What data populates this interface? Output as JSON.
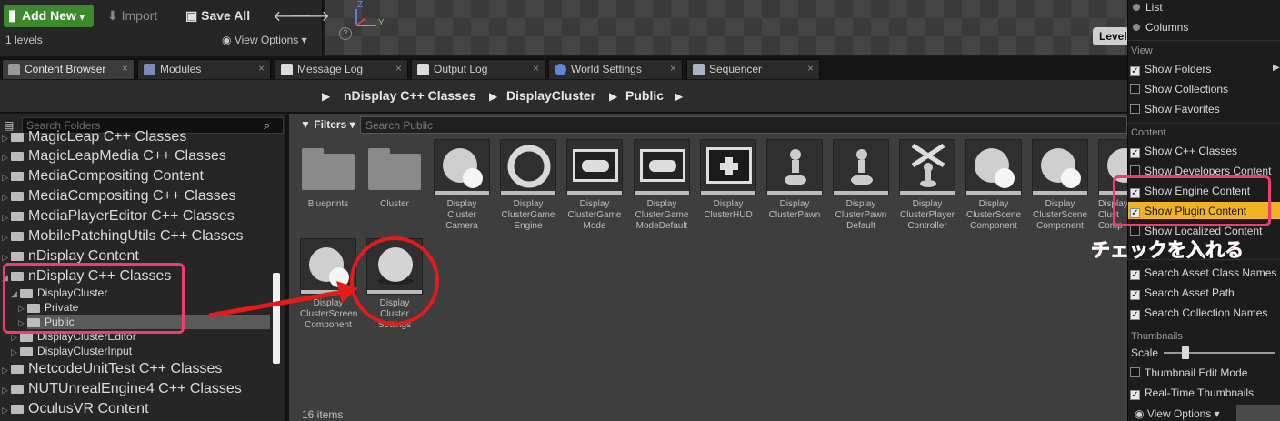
{
  "levels": {
    "count": "1 levels",
    "view_options": "View Options"
  },
  "viewport": {
    "level_badge": "Level:",
    "axis_y": "Y",
    "axis_z": "Z",
    "help": "?"
  },
  "tabs": [
    {
      "label": "Content Browser",
      "icon": "folder-icon"
    },
    {
      "label": "Modules",
      "icon": "modules-icon"
    },
    {
      "label": "Message Log",
      "icon": "message-log-icon"
    },
    {
      "label": "Output Log",
      "icon": "output-log-icon"
    },
    {
      "label": "World Settings",
      "icon": "globe-icon"
    },
    {
      "label": "Sequencer",
      "icon": "sequencer-icon"
    }
  ],
  "toolbar": {
    "add_new": "Add New",
    "import": "Import",
    "save_all": "Save All",
    "breadcrumbs": [
      "nDisplay C++ Classes",
      "DisplayCluster",
      "Public"
    ]
  },
  "sidebar": {
    "search_placeholder": "Search Folders",
    "items": [
      "MagicLeap C++ Classes",
      "MagicLeapMedia C++ Classes",
      "MediaCompositing Content",
      "MediaCompositing C++ Classes",
      "MediaPlayerEditor C++ Classes",
      "MobilePatchingUtils C++ Classes",
      "nDisplay Content",
      "nDisplay C++ Classes",
      "DisplayCluster",
      "Private",
      "Public",
      "DisplayClusterEditor",
      "DisplayClusterInput",
      "NetcodeUnitTest C++ Classes",
      "NUTUnrealEngine4 C++ Classes",
      "OculusVR Content"
    ]
  },
  "main": {
    "filters": "Filters",
    "search_placeholder": "Search Public",
    "items_count": "16 items",
    "assets": [
      {
        "label": "Blueprints",
        "kind": "folder"
      },
      {
        "label": "Cluster",
        "kind": "folder"
      },
      {
        "label": "Display\nCluster\nCamera",
        "kind": "sphere"
      },
      {
        "label": "Display\nClusterGame\nEngine",
        "kind": "ring"
      },
      {
        "label": "Display\nClusterGame\nMode",
        "kind": "gamepad"
      },
      {
        "label": "Display\nClusterGame\nModeDefault",
        "kind": "gamepad"
      },
      {
        "label": "Display\nClusterHUD",
        "kind": "hud"
      },
      {
        "label": "Display\nClusterPawn",
        "kind": "pawn"
      },
      {
        "label": "Display\nClusterPawn\nDefault",
        "kind": "pawn"
      },
      {
        "label": "Display\nClusterPlayer\nController",
        "kind": "controller"
      },
      {
        "label": "Display\nClusterScene\nComponent",
        "kind": "sphere"
      },
      {
        "label": "Display\nClusterScene\nComponent",
        "kind": "sphere"
      },
      {
        "label": "Display\nClust\nComp",
        "kind": "sphere"
      },
      {
        "label": "Display\nClusterScreen\nComponent",
        "kind": "sphere"
      },
      {
        "label": "Display\nCluster\nSettings",
        "kind": "sphere-single"
      }
    ]
  },
  "menu": {
    "list": "List",
    "columns": "Columns",
    "sec_view": "View",
    "show_folders": "Show Folders",
    "show_collections": "Show Collections",
    "show_favorites": "Show Favorites",
    "sec_content": "Content",
    "show_cpp": "Show C++ Classes",
    "show_dev": "Show Developers Content",
    "show_engine": "Show Engine Content",
    "show_plugin": "Show Plugin Content",
    "show_localized": "Show Localized Content",
    "search_asset_class": "Search Asset Class Names",
    "search_asset_path": "Search Asset Path",
    "search_collection": "Search Collection Names",
    "sec_thumbs": "Thumbnails",
    "scale": "Scale",
    "thumb_edit": "Thumbnail Edit Mode",
    "realtime": "Real-Time Thumbnails",
    "view_options": "View Options"
  },
  "annotation": {
    "note": "チェックを入れる"
  },
  "colors": {
    "accent_add": "#3d8a2e",
    "highlight": "#f0b323",
    "annotation_pink": "#ef3d6e",
    "annotation_red": "#e31b1b"
  }
}
